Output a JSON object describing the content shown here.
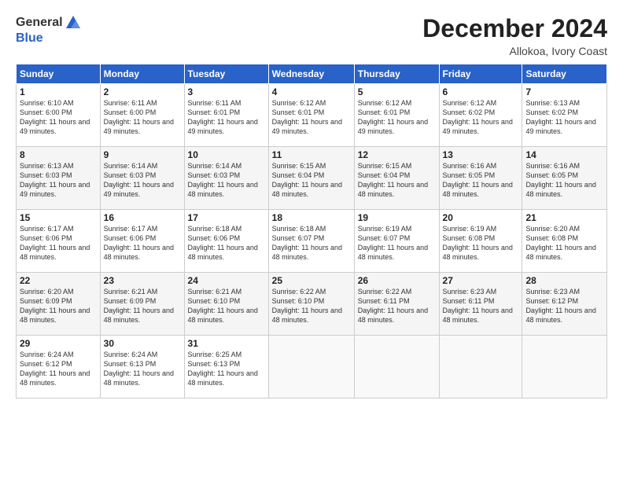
{
  "logo": {
    "general": "General",
    "blue": "Blue"
  },
  "title": "December 2024",
  "location": "Allokoa, Ivory Coast",
  "days_of_week": [
    "Sunday",
    "Monday",
    "Tuesday",
    "Wednesday",
    "Thursday",
    "Friday",
    "Saturday"
  ],
  "weeks": [
    [
      {
        "day": "1",
        "sunrise": "6:10 AM",
        "sunset": "6:00 PM",
        "daylight": "11 hours and 49 minutes."
      },
      {
        "day": "2",
        "sunrise": "6:11 AM",
        "sunset": "6:00 PM",
        "daylight": "11 hours and 49 minutes."
      },
      {
        "day": "3",
        "sunrise": "6:11 AM",
        "sunset": "6:01 PM",
        "daylight": "11 hours and 49 minutes."
      },
      {
        "day": "4",
        "sunrise": "6:12 AM",
        "sunset": "6:01 PM",
        "daylight": "11 hours and 49 minutes."
      },
      {
        "day": "5",
        "sunrise": "6:12 AM",
        "sunset": "6:01 PM",
        "daylight": "11 hours and 49 minutes."
      },
      {
        "day": "6",
        "sunrise": "6:12 AM",
        "sunset": "6:02 PM",
        "daylight": "11 hours and 49 minutes."
      },
      {
        "day": "7",
        "sunrise": "6:13 AM",
        "sunset": "6:02 PM",
        "daylight": "11 hours and 49 minutes."
      }
    ],
    [
      {
        "day": "8",
        "sunrise": "6:13 AM",
        "sunset": "6:03 PM",
        "daylight": "11 hours and 49 minutes."
      },
      {
        "day": "9",
        "sunrise": "6:14 AM",
        "sunset": "6:03 PM",
        "daylight": "11 hours and 49 minutes."
      },
      {
        "day": "10",
        "sunrise": "6:14 AM",
        "sunset": "6:03 PM",
        "daylight": "11 hours and 48 minutes."
      },
      {
        "day": "11",
        "sunrise": "6:15 AM",
        "sunset": "6:04 PM",
        "daylight": "11 hours and 48 minutes."
      },
      {
        "day": "12",
        "sunrise": "6:15 AM",
        "sunset": "6:04 PM",
        "daylight": "11 hours and 48 minutes."
      },
      {
        "day": "13",
        "sunrise": "6:16 AM",
        "sunset": "6:05 PM",
        "daylight": "11 hours and 48 minutes."
      },
      {
        "day": "14",
        "sunrise": "6:16 AM",
        "sunset": "6:05 PM",
        "daylight": "11 hours and 48 minutes."
      }
    ],
    [
      {
        "day": "15",
        "sunrise": "6:17 AM",
        "sunset": "6:06 PM",
        "daylight": "11 hours and 48 minutes."
      },
      {
        "day": "16",
        "sunrise": "6:17 AM",
        "sunset": "6:06 PM",
        "daylight": "11 hours and 48 minutes."
      },
      {
        "day": "17",
        "sunrise": "6:18 AM",
        "sunset": "6:06 PM",
        "daylight": "11 hours and 48 minutes."
      },
      {
        "day": "18",
        "sunrise": "6:18 AM",
        "sunset": "6:07 PM",
        "daylight": "11 hours and 48 minutes."
      },
      {
        "day": "19",
        "sunrise": "6:19 AM",
        "sunset": "6:07 PM",
        "daylight": "11 hours and 48 minutes."
      },
      {
        "day": "20",
        "sunrise": "6:19 AM",
        "sunset": "6:08 PM",
        "daylight": "11 hours and 48 minutes."
      },
      {
        "day": "21",
        "sunrise": "6:20 AM",
        "sunset": "6:08 PM",
        "daylight": "11 hours and 48 minutes."
      }
    ],
    [
      {
        "day": "22",
        "sunrise": "6:20 AM",
        "sunset": "6:09 PM",
        "daylight": "11 hours and 48 minutes."
      },
      {
        "day": "23",
        "sunrise": "6:21 AM",
        "sunset": "6:09 PM",
        "daylight": "11 hours and 48 minutes."
      },
      {
        "day": "24",
        "sunrise": "6:21 AM",
        "sunset": "6:10 PM",
        "daylight": "11 hours and 48 minutes."
      },
      {
        "day": "25",
        "sunrise": "6:22 AM",
        "sunset": "6:10 PM",
        "daylight": "11 hours and 48 minutes."
      },
      {
        "day": "26",
        "sunrise": "6:22 AM",
        "sunset": "6:11 PM",
        "daylight": "11 hours and 48 minutes."
      },
      {
        "day": "27",
        "sunrise": "6:23 AM",
        "sunset": "6:11 PM",
        "daylight": "11 hours and 48 minutes."
      },
      {
        "day": "28",
        "sunrise": "6:23 AM",
        "sunset": "6:12 PM",
        "daylight": "11 hours and 48 minutes."
      }
    ],
    [
      {
        "day": "29",
        "sunrise": "6:24 AM",
        "sunset": "6:12 PM",
        "daylight": "11 hours and 48 minutes."
      },
      {
        "day": "30",
        "sunrise": "6:24 AM",
        "sunset": "6:13 PM",
        "daylight": "11 hours and 48 minutes."
      },
      {
        "day": "31",
        "sunrise": "6:25 AM",
        "sunset": "6:13 PM",
        "daylight": "11 hours and 48 minutes."
      },
      null,
      null,
      null,
      null
    ]
  ]
}
